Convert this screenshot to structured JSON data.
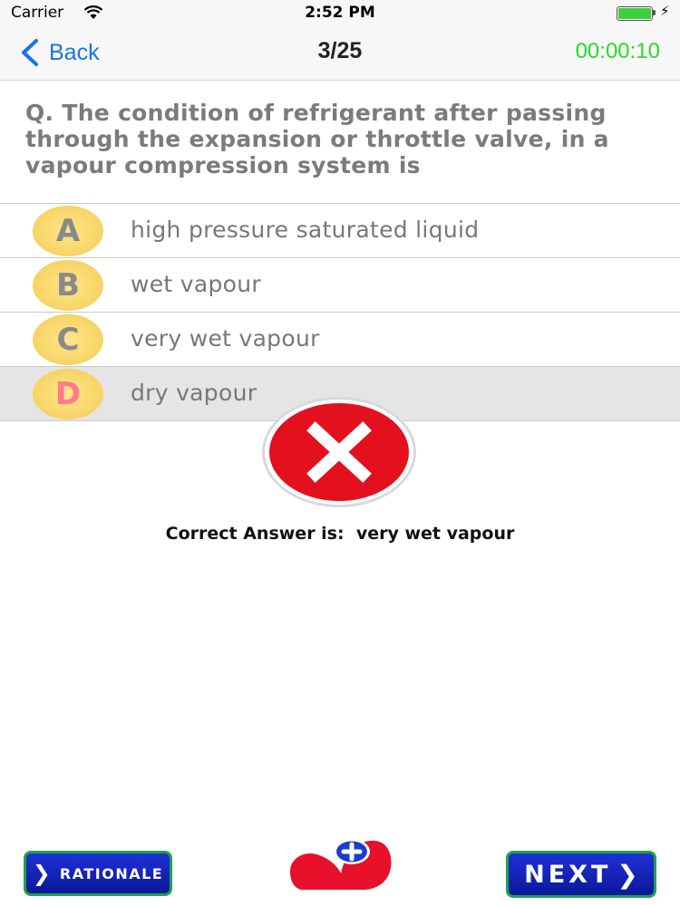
{
  "status_bar": {
    "carrier": "Carrier",
    "time": "2:52 PM",
    "icons": [
      "wifi-icon",
      "battery-icon",
      "charging-bolt-icon"
    ],
    "battery_level": 1.0
  },
  "nav": {
    "back_label": "Back",
    "progress": "3/25",
    "timer": "00:00:10",
    "colors": {
      "back": "#1a73e8",
      "timer": "#2bd92b"
    }
  },
  "question": {
    "text": "Q. The condition of refrigerant after passing through the expansion or throttle valve, in a vapour compression system is"
  },
  "options": [
    {
      "letter": "A",
      "text": "high pressure saturated liquid",
      "selected": false
    },
    {
      "letter": "B",
      "text": "wet vapour",
      "selected": false
    },
    {
      "letter": "C",
      "text": "very wet vapour",
      "selected": false
    },
    {
      "letter": "D",
      "text": "dry vapour",
      "selected": true
    }
  ],
  "result": {
    "icon": "wrong-x-icon",
    "correct_answer_text": "Correct Answer is:  very wet vapour",
    "colors": {
      "wrong": "#e3101e"
    }
  },
  "footer": {
    "rationale_label": "RATIONALE",
    "next_label": "NEXT",
    "favorite_icon": "heart-plus-icon",
    "colors": {
      "button_fill": "#1222c0",
      "button_border": "#1fa34a",
      "heart": "#e8102a"
    }
  }
}
